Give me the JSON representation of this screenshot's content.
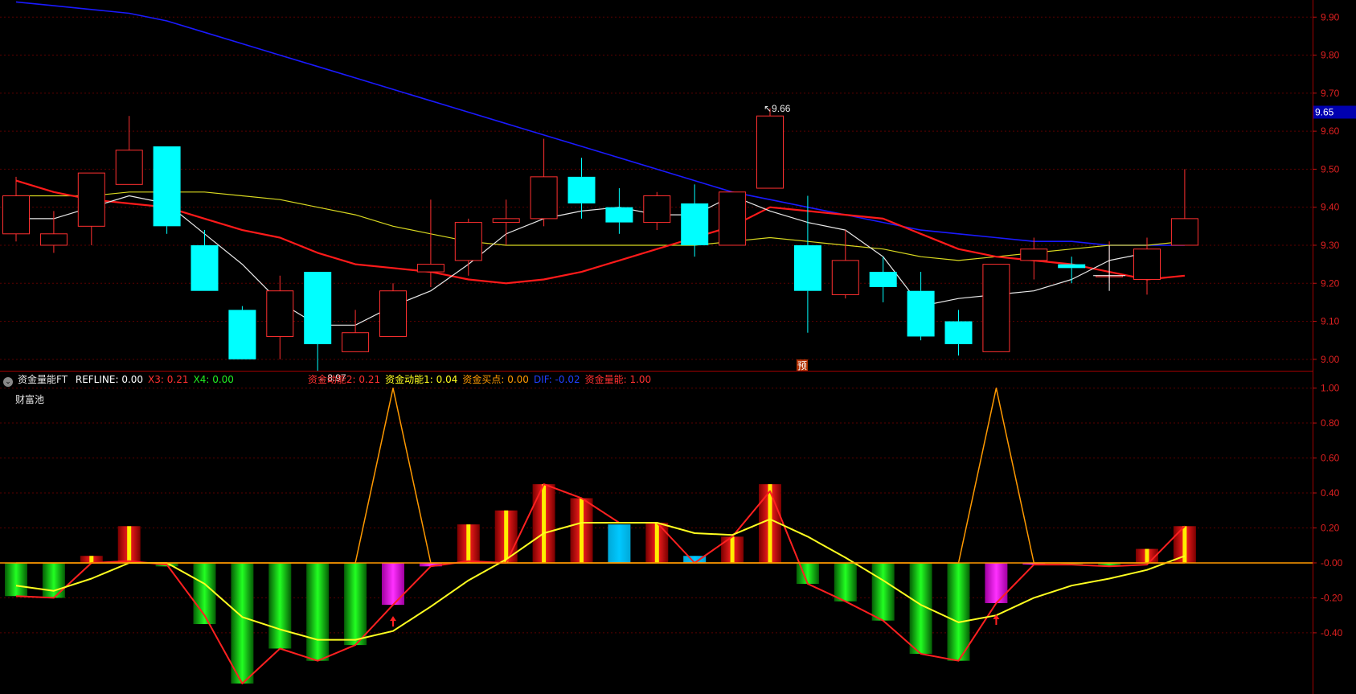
{
  "price_axis": {
    "ticks": [
      "9.90",
      "9.80",
      "9.70",
      "9.60",
      "9.50",
      "9.40",
      "9.30",
      "9.20",
      "9.10",
      "9.00"
    ],
    "current_price": "9.65",
    "high_label": "9.66",
    "low_label": "8.97",
    "marker_label": "预",
    "colors": {
      "up": "#ff3030",
      "down": "#00ffff",
      "grid": "#5a0000",
      "axis_text": "#e02020",
      "current_bg": "#0000b0"
    }
  },
  "indicator": {
    "title": "资金量能FT",
    "sub_title": "财富池",
    "legend": [
      {
        "name": "REFLINE:",
        "value": "0.00",
        "color": "#ffffff"
      },
      {
        "name": "X3:",
        "value": "0.21",
        "color": "#ff3030"
      },
      {
        "name": "X4:",
        "value": "0.00",
        "color": "#22ee22"
      },
      {
        "name": "资金动能2:",
        "value": "0.21",
        "color": "#ff3030"
      },
      {
        "name": "资金动能1:",
        "value": "0.04",
        "color": "#ffff20"
      },
      {
        "name": "资金买点:",
        "value": "0.00",
        "color": "#ff9900"
      },
      {
        "name": "DIF:",
        "value": "-0.02",
        "color": "#2040ff"
      },
      {
        "name": "资金量能:",
        "value": "1.00",
        "color": "#ff3030"
      }
    ],
    "ticks": [
      "1.00",
      "0.80",
      "0.60",
      "0.40",
      "0.20",
      "-0.00",
      "-0.20",
      "-0.40"
    ]
  },
  "chart_data": [
    {
      "type": "candlestick",
      "ylim": [
        8.95,
        9.95
      ],
      "candles": [
        {
          "o": 9.33,
          "h": 9.48,
          "l": 9.31,
          "c": 9.43
        },
        {
          "o": 9.3,
          "h": 9.39,
          "l": 9.28,
          "c": 9.33
        },
        {
          "o": 9.35,
          "h": 9.45,
          "l": 9.3,
          "c": 9.49
        },
        {
          "o": 9.46,
          "h": 9.64,
          "l": 9.46,
          "c": 9.55
        },
        {
          "o": 9.56,
          "h": 9.56,
          "l": 9.33,
          "c": 9.35
        },
        {
          "o": 9.3,
          "h": 9.34,
          "l": 9.18,
          "c": 9.18
        },
        {
          "o": 9.13,
          "h": 9.14,
          "l": 9.0,
          "c": 9.0
        },
        {
          "o": 9.06,
          "h": 9.22,
          "l": 9.0,
          "c": 9.18
        },
        {
          "o": 9.23,
          "h": 9.23,
          "l": 8.97,
          "c": 9.04
        },
        {
          "o": 9.02,
          "h": 9.13,
          "l": 9.02,
          "c": 9.07
        },
        {
          "o": 9.06,
          "h": 9.2,
          "l": 9.06,
          "c": 9.18
        },
        {
          "o": 9.23,
          "h": 9.42,
          "l": 9.19,
          "c": 9.25
        },
        {
          "o": 9.26,
          "h": 9.37,
          "l": 9.22,
          "c": 9.36
        },
        {
          "o": 9.36,
          "h": 9.42,
          "l": 9.3,
          "c": 9.37
        },
        {
          "o": 9.37,
          "h": 9.58,
          "l": 9.35,
          "c": 9.48
        },
        {
          "o": 9.48,
          "h": 9.53,
          "l": 9.37,
          "c": 9.41
        },
        {
          "o": 9.4,
          "h": 9.45,
          "l": 9.33,
          "c": 9.36
        },
        {
          "o": 9.36,
          "h": 9.44,
          "l": 9.34,
          "c": 9.43
        },
        {
          "o": 9.41,
          "h": 9.46,
          "l": 9.27,
          "c": 9.3
        },
        {
          "o": 9.3,
          "h": 9.44,
          "l": 9.3,
          "c": 9.44
        },
        {
          "o": 9.45,
          "h": 9.66,
          "l": 9.45,
          "c": 9.64
        },
        {
          "o": 9.3,
          "h": 9.43,
          "l": 9.07,
          "c": 9.18
        },
        {
          "o": 9.17,
          "h": 9.34,
          "l": 9.16,
          "c": 9.26
        },
        {
          "o": 9.23,
          "h": 9.27,
          "l": 9.15,
          "c": 9.19
        },
        {
          "o": 9.18,
          "h": 9.23,
          "l": 9.05,
          "c": 9.06
        },
        {
          "o": 9.1,
          "h": 9.13,
          "l": 9.01,
          "c": 9.04
        },
        {
          "o": 9.02,
          "h": 9.25,
          "l": 9.02,
          "c": 9.25
        },
        {
          "o": 9.26,
          "h": 9.32,
          "l": 9.21,
          "c": 9.29
        },
        {
          "o": 9.25,
          "h": 9.27,
          "l": 9.2,
          "c": 9.24
        },
        {
          "o": 9.22,
          "h": 9.31,
          "l": 9.2,
          "c": 9.22
        },
        {
          "o": 9.21,
          "h": 9.32,
          "l": 9.17,
          "c": 9.29
        },
        {
          "o": 9.3,
          "h": 9.5,
          "l": 9.3,
          "c": 9.37
        }
      ],
      "ma_white": [
        9.37,
        9.37,
        9.4,
        9.43,
        9.41,
        9.33,
        9.25,
        9.15,
        9.09,
        9.09,
        9.14,
        9.18,
        9.25,
        9.33,
        9.37,
        9.39,
        9.4,
        9.38,
        9.38,
        9.43,
        9.39,
        9.36,
        9.34,
        9.27,
        9.14,
        9.16,
        9.17,
        9.18,
        9.21,
        9.26,
        9.28,
        null
      ],
      "ma_red": [
        9.47,
        9.44,
        9.42,
        9.41,
        9.4,
        9.37,
        9.34,
        9.32,
        9.28,
        9.25,
        9.24,
        9.23,
        9.21,
        9.2,
        9.21,
        9.23,
        9.26,
        9.29,
        9.32,
        9.35,
        9.4,
        9.39,
        9.38,
        9.37,
        9.33,
        9.29,
        9.27,
        9.26,
        9.25,
        9.23,
        9.21,
        9.22
      ],
      "ma_yellow": [
        9.43,
        9.43,
        9.43,
        9.44,
        9.44,
        9.44,
        9.43,
        9.42,
        9.4,
        9.38,
        9.35,
        9.33,
        9.31,
        9.3,
        9.3,
        9.3,
        9.3,
        9.3,
        9.3,
        9.31,
        9.32,
        9.31,
        9.3,
        9.29,
        9.27,
        9.26,
        9.27,
        9.28,
        9.29,
        9.3,
        9.3,
        9.31
      ],
      "ma_blue": [
        9.94,
        9.93,
        9.92,
        9.91,
        9.89,
        9.86,
        9.83,
        9.8,
        9.77,
        9.74,
        9.71,
        9.68,
        9.65,
        9.62,
        9.59,
        9.56,
        9.53,
        9.5,
        9.47,
        9.44,
        9.42,
        9.4,
        9.38,
        9.36,
        9.34,
        9.33,
        9.32,
        9.31,
        9.31,
        9.3,
        9.3,
        9.3
      ]
    },
    {
      "type": "bar",
      "ylim": [
        -0.7,
        1.1
      ],
      "bars": [
        {
          "v": -0.19,
          "c": "green"
        },
        {
          "v": -0.2,
          "c": "green"
        },
        {
          "v": 0.04,
          "c": "red"
        },
        {
          "v": 0.21,
          "c": "red"
        },
        {
          "v": -0.02,
          "c": "green"
        },
        {
          "v": -0.35,
          "c": "green"
        },
        {
          "v": -0.69,
          "c": "green"
        },
        {
          "v": -0.49,
          "c": "green"
        },
        {
          "v": -0.56,
          "c": "green"
        },
        {
          "v": -0.47,
          "c": "green"
        },
        {
          "v": -0.24,
          "c": "magenta"
        },
        {
          "v": -0.02,
          "c": "magenta"
        },
        {
          "v": 0.22,
          "c": "red"
        },
        {
          "v": 0.3,
          "c": "red"
        },
        {
          "v": 0.45,
          "c": "red"
        },
        {
          "v": 0.37,
          "c": "red"
        },
        {
          "v": 0.22,
          "c": "cyan"
        },
        {
          "v": 0.23,
          "c": "red"
        },
        {
          "v": 0.04,
          "c": "cyan"
        },
        {
          "v": 0.15,
          "c": "red"
        },
        {
          "v": 0.45,
          "c": "red"
        },
        {
          "v": -0.12,
          "c": "green"
        },
        {
          "v": -0.22,
          "c": "green"
        },
        {
          "v": -0.33,
          "c": "green"
        },
        {
          "v": -0.52,
          "c": "green"
        },
        {
          "v": -0.56,
          "c": "green"
        },
        {
          "v": -0.23,
          "c": "magenta"
        },
        {
          "v": -0.01,
          "c": "magenta"
        },
        {
          "v": -0.01,
          "c": "green"
        },
        {
          "v": -0.02,
          "c": "green"
        },
        {
          "v": 0.08,
          "c": "red"
        },
        {
          "v": 0.21,
          "c": "red"
        }
      ],
      "series": [
        {
          "name": "资金动能2",
          "color": "#ff2020",
          "values": [
            -0.19,
            -0.2,
            0.0,
            0.01,
            -0.01,
            -0.3,
            -0.69,
            -0.49,
            -0.56,
            -0.47,
            -0.24,
            -0.02,
            0.01,
            0.0,
            0.45,
            0.37,
            0.23,
            0.23,
            0.0,
            0.15,
            0.41,
            -0.12,
            -0.22,
            -0.33,
            -0.52,
            -0.56,
            -0.23,
            -0.01,
            -0.01,
            -0.02,
            -0.01,
            0.21
          ]
        },
        {
          "name": "资金动能1",
          "color": "#ffff20",
          "values": [
            -0.13,
            -0.16,
            -0.09,
            0.0,
            0.0,
            -0.12,
            -0.31,
            -0.38,
            -0.44,
            -0.44,
            -0.39,
            -0.25,
            -0.1,
            0.02,
            0.17,
            0.23,
            0.23,
            0.23,
            0.17,
            0.16,
            0.25,
            0.15,
            0.03,
            -0.1,
            -0.24,
            -0.34,
            -0.3,
            -0.2,
            -0.13,
            -0.09,
            -0.04,
            0.04
          ]
        },
        {
          "name": "资金买点",
          "color": "#ff9900",
          "values": [
            0,
            0,
            0,
            0,
            0,
            0,
            0,
            0,
            0,
            0,
            1.0,
            0,
            0,
            0,
            0,
            0,
            0,
            0,
            0,
            0,
            0,
            0,
            0,
            0,
            0,
            0,
            1.0,
            0,
            0,
            0,
            0,
            0
          ]
        }
      ],
      "arrows_at": [
        10,
        26
      ]
    }
  ]
}
